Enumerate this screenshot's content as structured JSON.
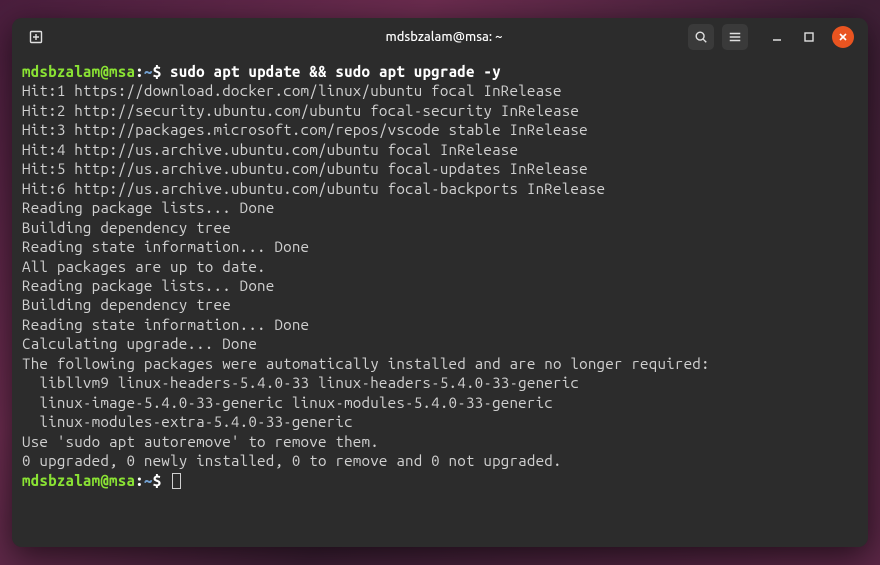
{
  "titlebar": {
    "title": "mdsbzalam@msa: ~"
  },
  "prompt": {
    "user_host": "mdsbzalam@msa",
    "colon": ":",
    "path": "~",
    "dollar": "$ "
  },
  "command1": "sudo apt update && sudo apt upgrade -y",
  "output": [
    "Hit:1 https://download.docker.com/linux/ubuntu focal InRelease",
    "Hit:2 http://security.ubuntu.com/ubuntu focal-security InRelease",
    "Hit:3 http://packages.microsoft.com/repos/vscode stable InRelease",
    "Hit:4 http://us.archive.ubuntu.com/ubuntu focal InRelease",
    "Hit:5 http://us.archive.ubuntu.com/ubuntu focal-updates InRelease",
    "Hit:6 http://us.archive.ubuntu.com/ubuntu focal-backports InRelease",
    "Reading package lists... Done",
    "Building dependency tree",
    "Reading state information... Done",
    "All packages are up to date.",
    "Reading package lists... Done",
    "Building dependency tree",
    "Reading state information... Done",
    "Calculating upgrade... Done",
    "The following packages were automatically installed and are no longer required:",
    "  libllvm9 linux-headers-5.4.0-33 linux-headers-5.4.0-33-generic",
    "  linux-image-5.4.0-33-generic linux-modules-5.4.0-33-generic",
    "  linux-modules-extra-5.4.0-33-generic",
    "Use 'sudo apt autoremove' to remove them.",
    "0 upgraded, 0 newly installed, 0 to remove and 0 not upgraded."
  ]
}
